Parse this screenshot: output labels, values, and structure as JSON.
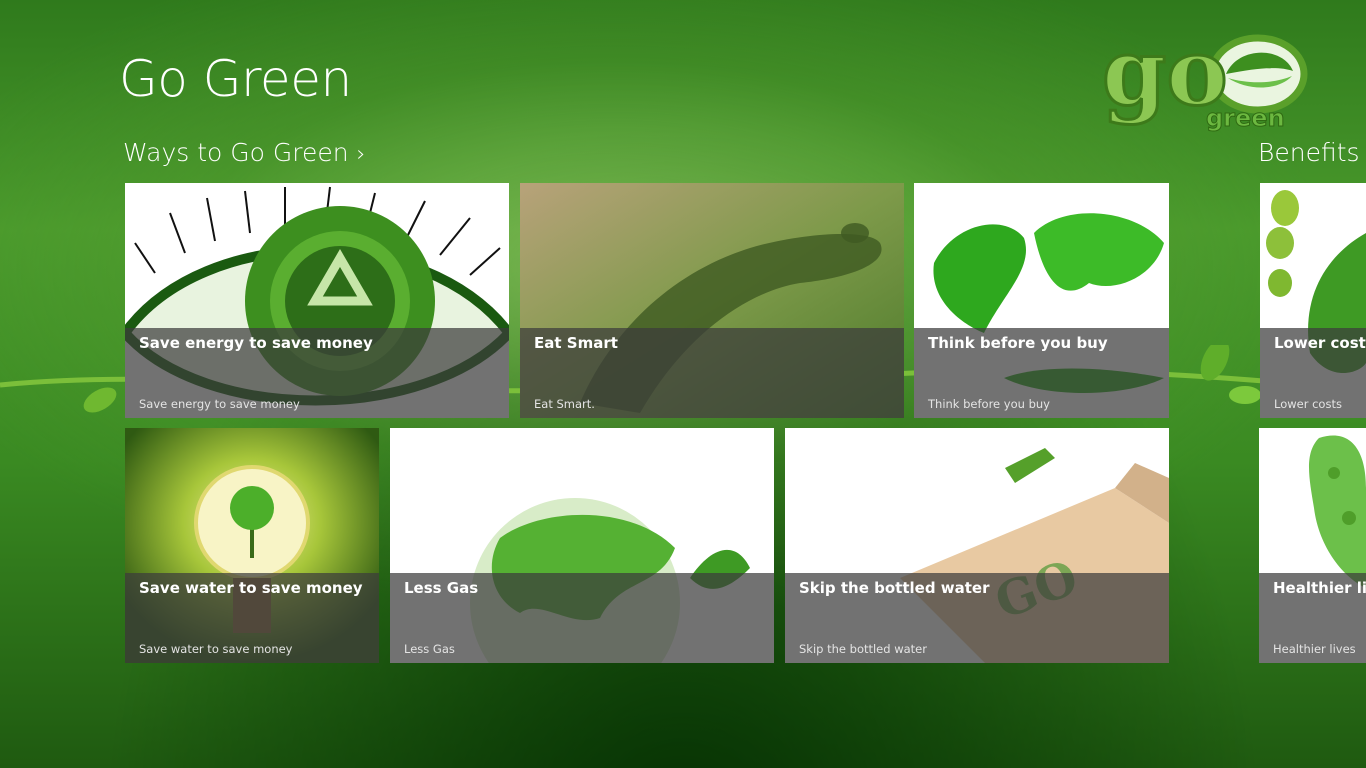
{
  "app": {
    "title": "Go Green",
    "logo_text": {
      "top": "go",
      "bottom": "green"
    }
  },
  "groups": [
    {
      "header": "Ways to Go Green",
      "chevron": "›",
      "tiles": [
        {
          "title": "Save energy to save money",
          "subtitle": "Save energy to save money",
          "icon": "recycle-eye-image"
        },
        {
          "title": "Eat Smart",
          "subtitle": "Eat Smart.",
          "icon": "footprint-image"
        },
        {
          "title": "Think before you buy",
          "subtitle": "Think before you buy",
          "icon": "green-world-map-image"
        },
        {
          "title": "Save water to save money",
          "subtitle": "Save water to save money",
          "icon": "lightbulb-tree-image"
        },
        {
          "title": "Less Gas",
          "subtitle": "Less Gas",
          "icon": "green-globe-image"
        },
        {
          "title": "Skip the bottled water",
          "subtitle": "Skip the bottled water",
          "icon": "go-green-sign-image"
        }
      ]
    },
    {
      "header": "Benefits o",
      "tiles": [
        {
          "title": "Lower costs",
          "subtitle": "Lower costs",
          "icon": "green-footprint-image"
        },
        {
          "title": "Healthier lives",
          "subtitle": "Healthier lives",
          "icon": "leaf-tree-image"
        }
      ]
    }
  ],
  "colors": {
    "background": "#3a8a22",
    "overlay": "rgba(60,60,60,0.72)",
    "accent": "#6cc04a"
  }
}
